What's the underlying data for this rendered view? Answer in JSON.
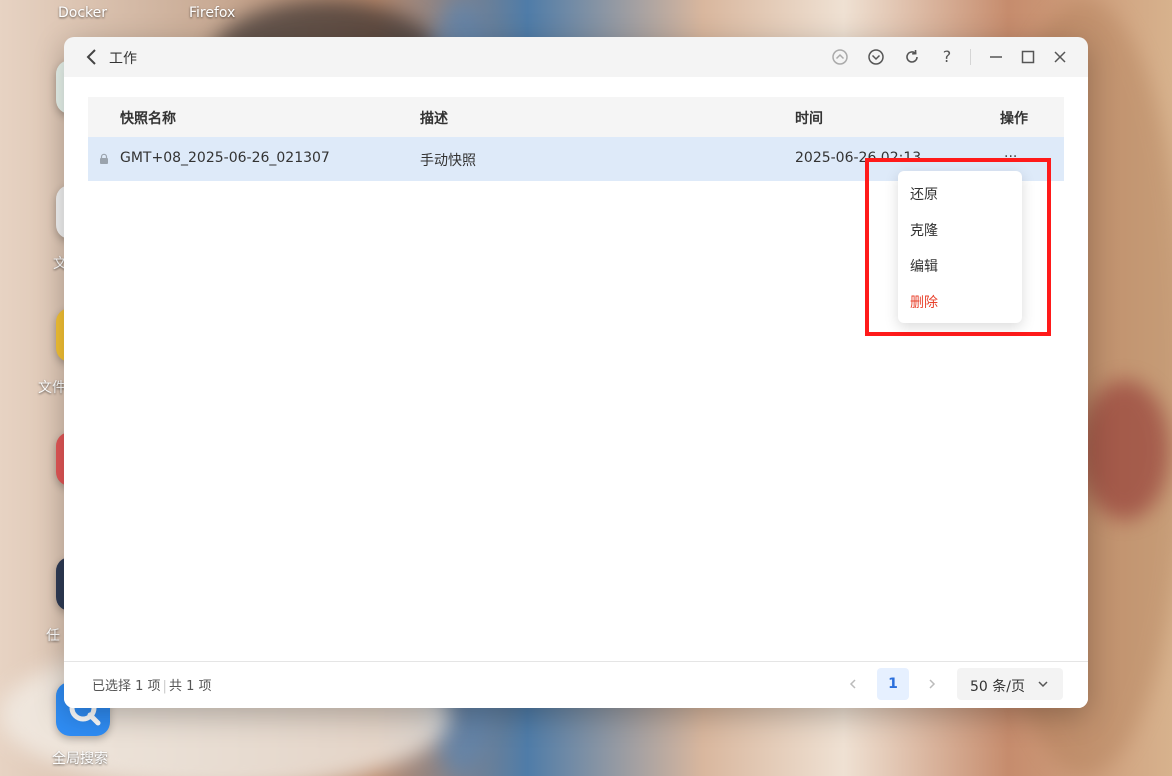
{
  "desktop": {
    "labels": {
      "docker": "Docker",
      "firefox": "Firefox",
      "wen1": "文",
      "wenjian": "文件",
      "ren": "任",
      "search": "全局搜索"
    }
  },
  "window": {
    "title": "工作",
    "toolbar_icons": [
      "scroll-up-icon",
      "scroll-down-icon",
      "refresh-icon",
      "help-icon",
      "minimize-icon",
      "maximize-icon",
      "close-icon"
    ],
    "help_glyph": "?"
  },
  "table": {
    "columns": [
      "快照名称",
      "描述",
      "时间",
      "操作"
    ],
    "rows": [
      {
        "name": "GMT+08_2025-06-26_021307",
        "description": "手动快照",
        "time": "2025-06-26 02:13",
        "action": "..."
      }
    ]
  },
  "context_menu": {
    "items": [
      {
        "label": "还原",
        "color": "#333333"
      },
      {
        "label": "克隆",
        "color": "#333333"
      },
      {
        "label": "编辑",
        "color": "#333333"
      },
      {
        "label": "删除",
        "color": "#e8412c"
      }
    ]
  },
  "footer": {
    "selected": "已选择 1 项",
    "total": "共 1 项",
    "current_page": "1",
    "page_size": "50 条/页"
  },
  "colors": {
    "accent": "#2b6fdc",
    "selected_row": "#deeaf9",
    "danger": "#e8412c",
    "highlight": "#ff1a1a"
  }
}
